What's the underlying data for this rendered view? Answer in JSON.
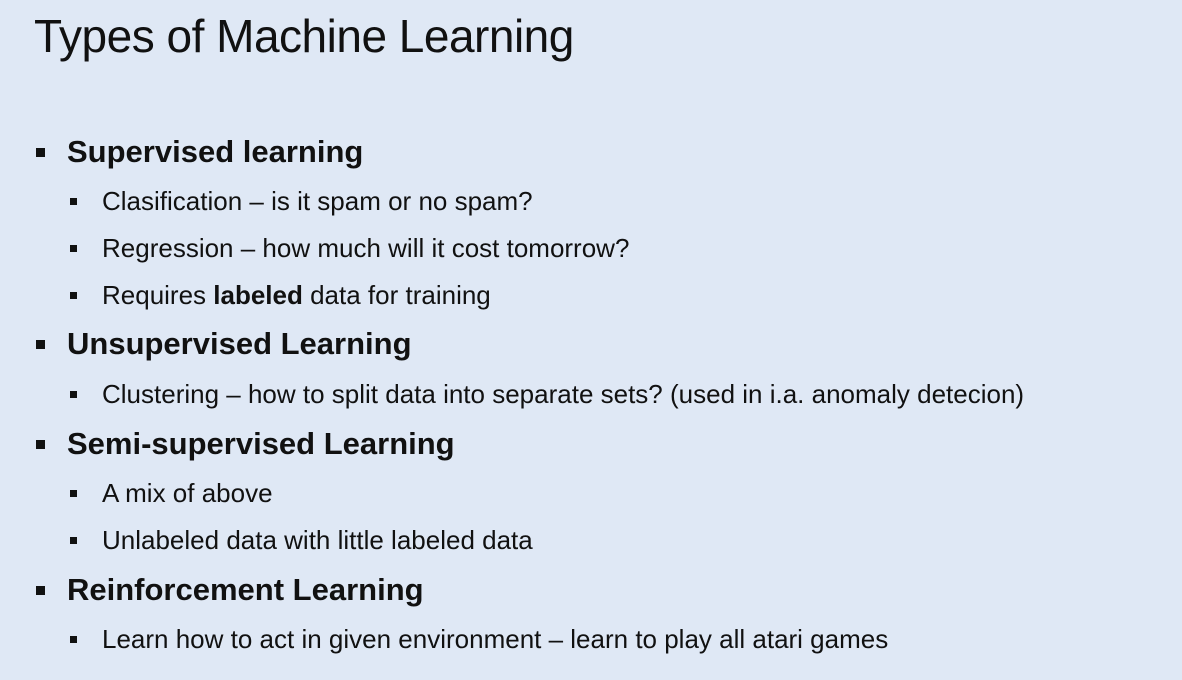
{
  "slide": {
    "title": "Types of Machine Learning",
    "sections": [
      {
        "heading": "Supervised learning",
        "items": [
          "Clasification – is it spam or no spam?",
          "Regression – how much will it cost tomorrow?",
          {
            "before": "Requires ",
            "bold": "labeled",
            "after": " data for training"
          }
        ]
      },
      {
        "heading": "Unsupervised Learning",
        "items": [
          "Clustering – how to split data into separate sets? (used in i.a. anomaly detecion)"
        ]
      },
      {
        "heading": "Semi-supervised Learning",
        "items": [
          "A mix of above",
          "Unlabeled data with little labeled data"
        ]
      },
      {
        "heading": "Reinforcement Learning",
        "items": [
          "Learn how to act in given environment – learn to play all atari games"
        ]
      }
    ]
  }
}
